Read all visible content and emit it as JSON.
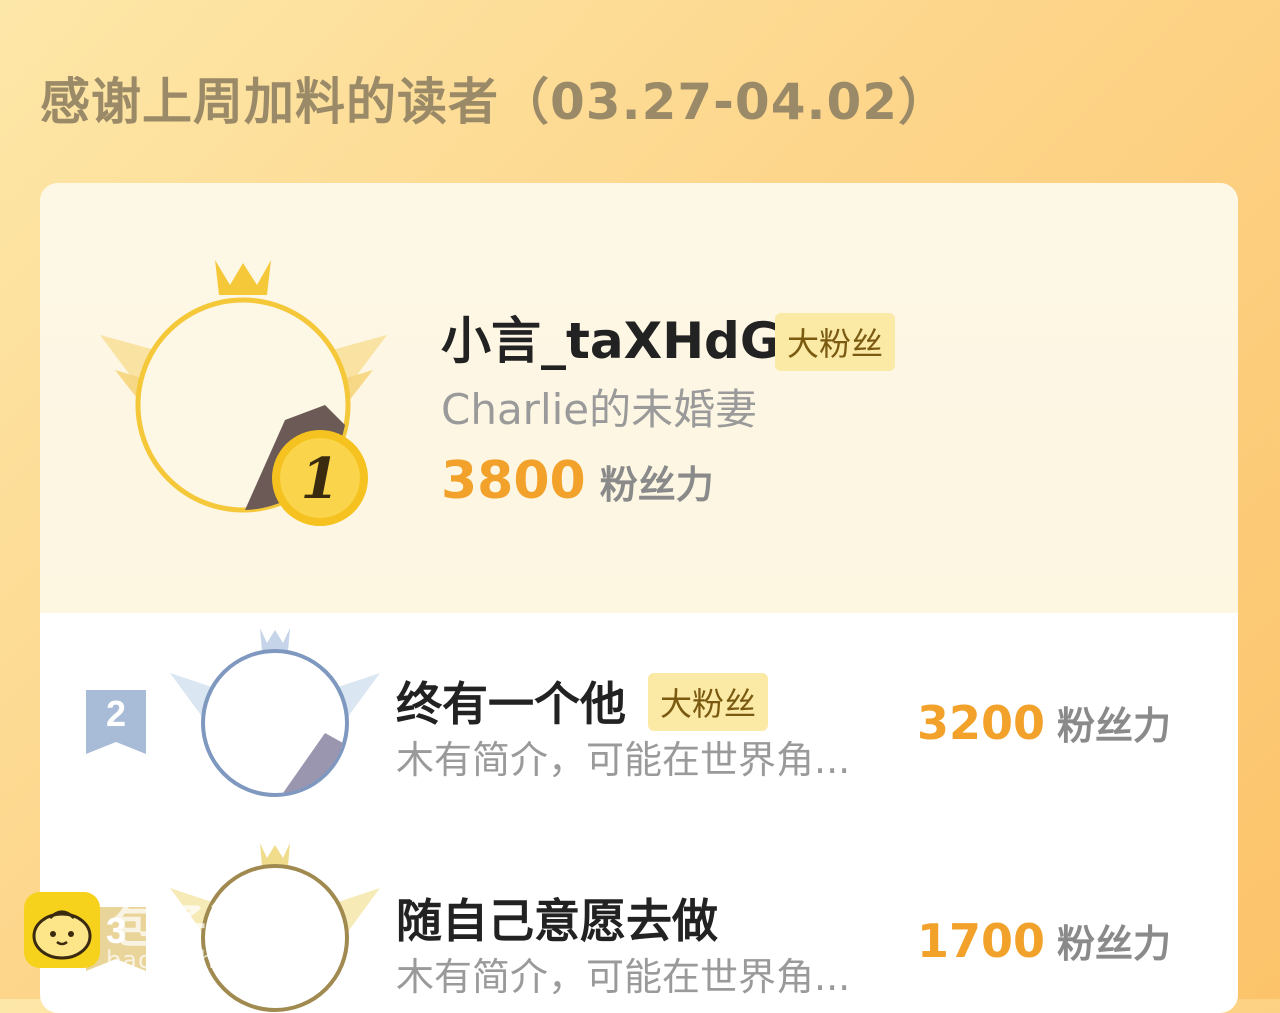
{
  "header": {
    "title": "感谢上周加料的读者（03.27-04.02）"
  },
  "winner": {
    "rank": "1",
    "name": "小言_taXHdG",
    "badge": "大粉丝",
    "desc": "Charlie的未婚妻",
    "score": "3800",
    "unit": "粉丝力"
  },
  "ranking": [
    {
      "rank": "2",
      "name": "终有一个他",
      "badge": "大粉丝",
      "desc": "木有简介，可能在世界角...",
      "score": "3200",
      "unit": "粉丝力"
    },
    {
      "rank": "3",
      "name": "随自己意愿去做",
      "badge": "",
      "desc": "木有简介，可能在世界角...",
      "score": "1700",
      "unit": "粉丝力"
    }
  ],
  "watermark": {
    "text": "包子漫畫",
    "url": "baozimh.com"
  },
  "colors": {
    "gold": "#f2a22a",
    "silver": "#7f98bf",
    "bronze": "#a08a50"
  }
}
